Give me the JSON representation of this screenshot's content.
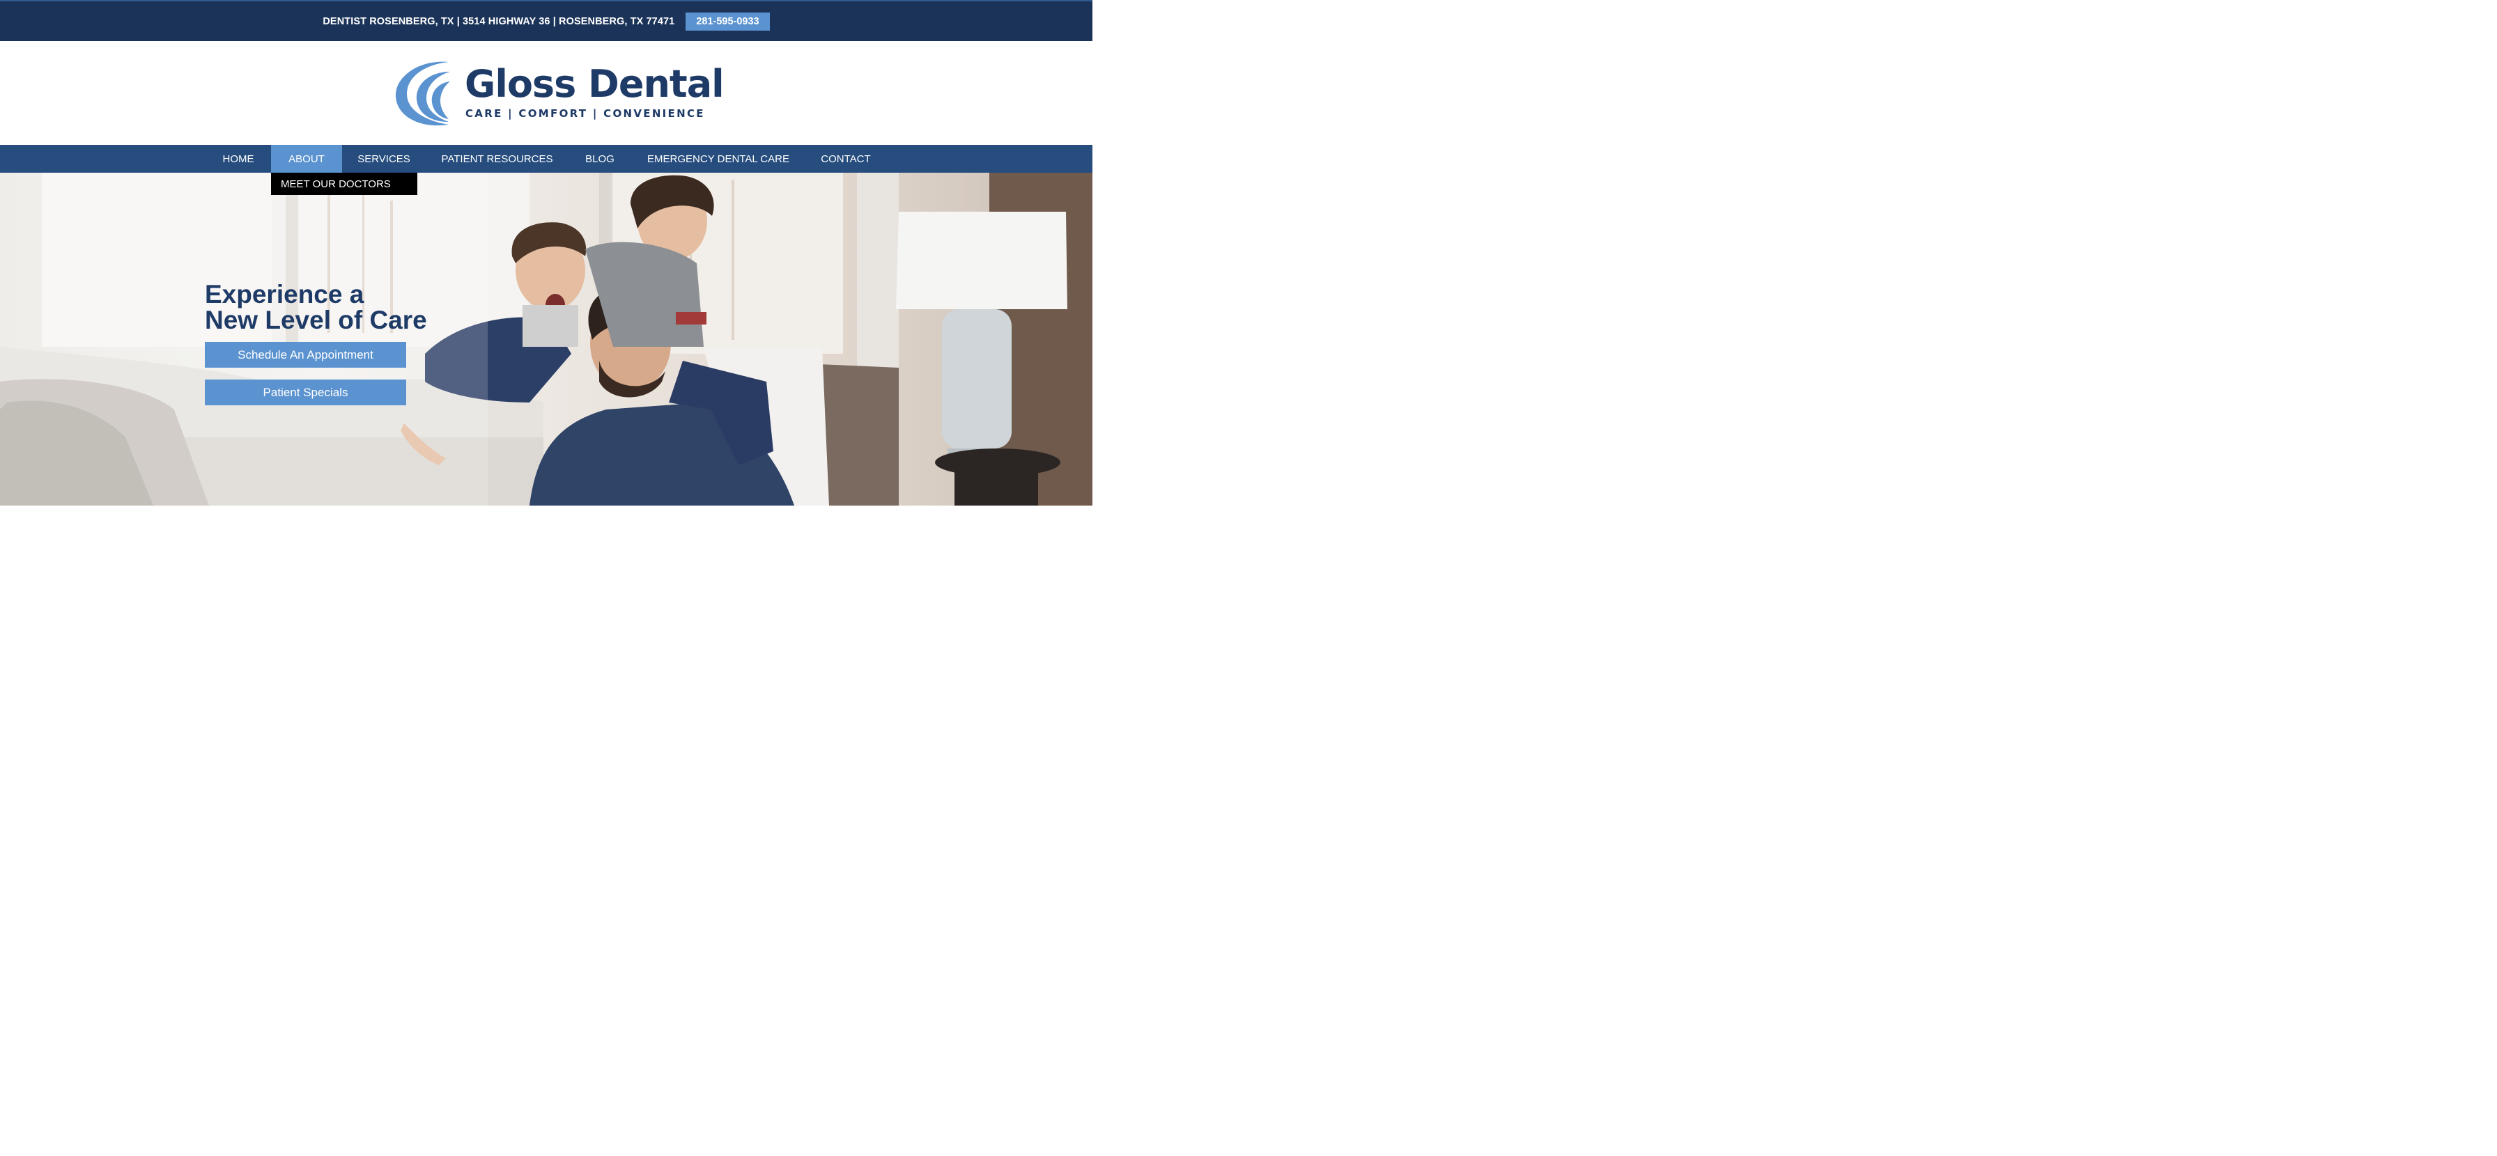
{
  "topbar": {
    "address": "DENTIST ROSENBERG, TX | 3514 HIGHWAY 36 | ROSENBERG, TX 77471",
    "phone": "281-595-0933"
  },
  "logo": {
    "name": "Gloss Dental",
    "tagline": "CARE | COMFORT | CONVENIENCE",
    "icon": "gloss-wave-logo-icon"
  },
  "nav": {
    "items": [
      {
        "label": "HOME"
      },
      {
        "label": "ABOUT",
        "active": true
      },
      {
        "label": "SERVICES"
      },
      {
        "label": "PATIENT RESOURCES"
      },
      {
        "label": "BLOG"
      },
      {
        "label": "EMERGENCY DENTAL CARE"
      },
      {
        "label": "CONTACT"
      }
    ],
    "dropdown": {
      "label": "MEET OUR DOCTORS"
    }
  },
  "hero": {
    "headline_line1": "Experience a",
    "headline_line2": "New Level of Care",
    "cta_primary": "Schedule An Appointment",
    "cta_secondary": "Patient Specials"
  },
  "colors": {
    "navy": "#1b3358",
    "nav": "#264d7e",
    "accent": "#5b93d0",
    "brand_text": "#1e3a66"
  }
}
